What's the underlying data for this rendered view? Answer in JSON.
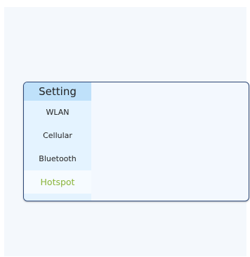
{
  "settings_panel": {
    "title": "Setting",
    "items": [
      {
        "label": "WLAN"
      },
      {
        "label": "Cellular"
      },
      {
        "label": "Bluetooth"
      },
      {
        "label": "Hotspot",
        "active": true
      }
    ],
    "colors": {
      "header_bg": "#bfe1fa",
      "sidebar_bg": "#e4f3ff",
      "active_text": "#8ab43a",
      "border": "#2f4a78"
    }
  }
}
